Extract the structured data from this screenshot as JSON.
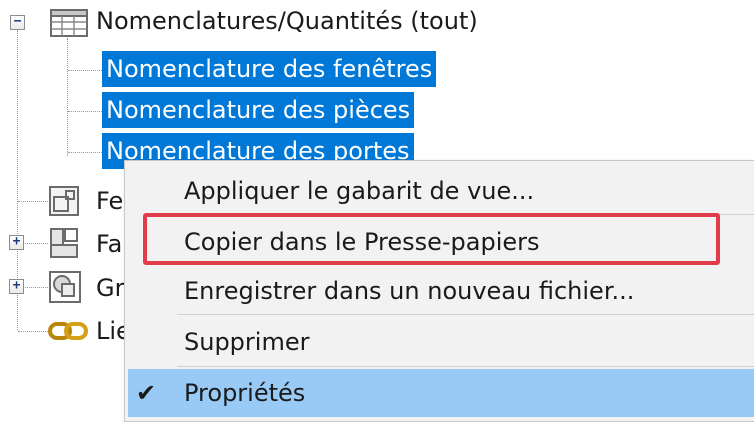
{
  "tree": {
    "root": {
      "expander": "−",
      "label": "Nomenclatures/Quantités (tout)",
      "icon": "table-icon"
    },
    "children": [
      {
        "label": "Nomenclature des fenêtres"
      },
      {
        "label": "Nomenclature des pièces"
      },
      {
        "label": "Nomenclature des portes"
      }
    ],
    "siblings": [
      {
        "label": "Fe",
        "icon": "sheet-icon",
        "expander": ""
      },
      {
        "label": "Fa",
        "icon": "family-icon",
        "expander": "+"
      },
      {
        "label": "Gr",
        "icon": "group-icon",
        "expander": "+"
      },
      {
        "label": "Lie",
        "icon": "link-icon",
        "expander": ""
      }
    ]
  },
  "context_menu": {
    "items": [
      {
        "label": "Appliquer le gabarit de vue..."
      },
      {
        "label": "Copier dans le Presse-papiers"
      },
      {
        "label": "Enregistrer dans un nouveau fichier..."
      },
      {
        "label": "Supprimer"
      },
      {
        "label": "Propriétés",
        "checked": true
      }
    ],
    "check_glyph": "✔"
  },
  "colors": {
    "selection": "#0078d7",
    "menu_active": "#99c9f5",
    "highlight_box": "#e03c4a"
  }
}
